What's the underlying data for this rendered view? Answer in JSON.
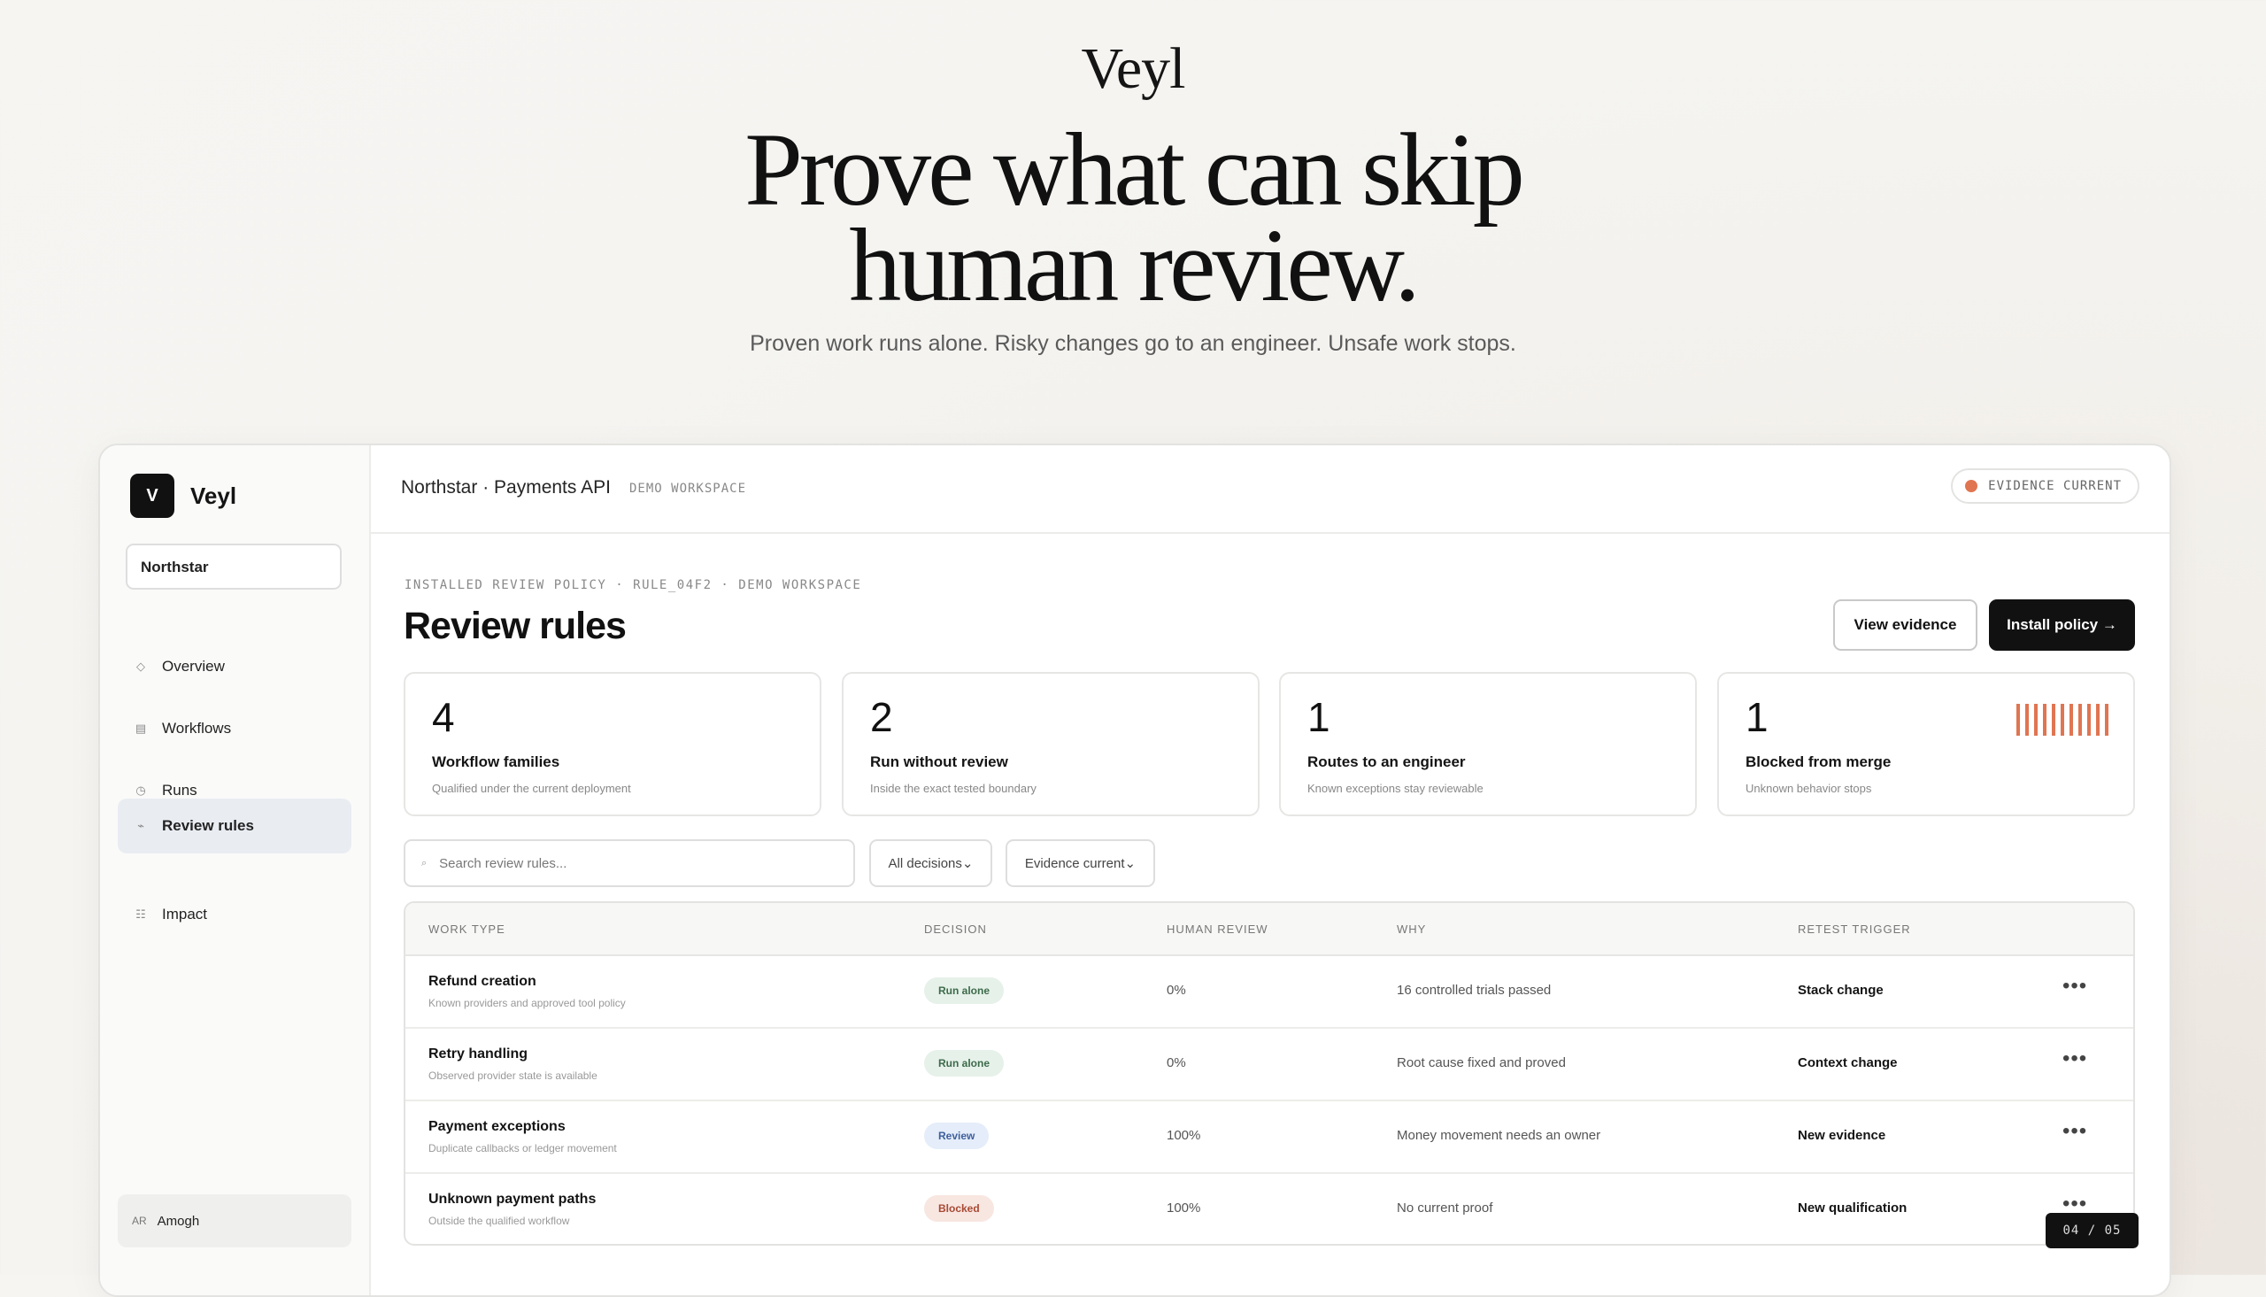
{
  "hero": {
    "brand": "Veyl",
    "title_line1": "Prove what can skip",
    "title_line2": "human review.",
    "subtitle": "Proven work runs alone. Risky changes go to an engineer. Unsafe work stops."
  },
  "sidebar": {
    "logo_letter": "V",
    "app_name": "Veyl",
    "workspace": "Northstar",
    "items": [
      {
        "label": "Overview",
        "icon": "diamond-icon",
        "glyph": "◇"
      },
      {
        "label": "Workflows",
        "icon": "grid-icon",
        "glyph": "▤"
      },
      {
        "label": "Runs",
        "icon": "clock-icon",
        "glyph": "◷"
      },
      {
        "label": "Review rules",
        "icon": "rule-icon",
        "glyph": "⌁"
      },
      {
        "label": "Impact",
        "icon": "list-icon",
        "glyph": "☷"
      }
    ],
    "active_item": "Review rules",
    "user": {
      "initials": "AR",
      "name": "Amogh"
    }
  },
  "topbar": {
    "breadcrumb": "Northstar · Payments API",
    "tag": "DEMO WORKSPACE",
    "evidence_status": "EVIDENCE CURRENT"
  },
  "main": {
    "eyebrow": "INSTALLED REVIEW POLICY · RULE_04F2 · DEMO WORKSPACE",
    "title": "Review rules",
    "view_evidence": "View evidence",
    "install_policy": "Install policy →",
    "cards": [
      {
        "num": "4",
        "label": "Workflow families",
        "sub": "Qualified under the current deployment"
      },
      {
        "num": "2",
        "label": "Run without review",
        "sub": "Inside the exact tested boundary"
      },
      {
        "num": "1",
        "label": "Routes to an engineer",
        "sub": "Known exceptions stay reviewable"
      },
      {
        "num": "1",
        "label": "Blocked from merge",
        "sub": "Unknown behavior stops"
      }
    ],
    "search_placeholder": "Search review rules...",
    "filter_decisions": "All decisions⌄",
    "filter_evidence": "Evidence current⌄"
  },
  "table": {
    "headers": {
      "work_type": "WORK TYPE",
      "decision": "DECISION",
      "human_review": "HUMAN REVIEW",
      "why": "WHY",
      "retest": "RETEST TRIGGER"
    },
    "rows": [
      {
        "title": "Refund creation",
        "sub": "Known providers and approved tool policy",
        "decision": "Run alone",
        "review": "0%",
        "why": "16 controlled trials passed",
        "trigger": "Stack change"
      },
      {
        "title": "Retry handling",
        "sub": "Observed provider state is available",
        "decision": "Run alone",
        "review": "0%",
        "why": "Root cause fixed and proved",
        "trigger": "Context change"
      },
      {
        "title": "Payment exceptions",
        "sub": "Duplicate callbacks or ledger movement",
        "decision": "Review",
        "review": "100%",
        "why": "Money movement needs an owner",
        "trigger": "New evidence"
      },
      {
        "title": "Unknown payment paths",
        "sub": "Outside the qualified workflow",
        "decision": "Blocked",
        "review": "100%",
        "why": "No current proof",
        "trigger": "New qualification"
      }
    ]
  },
  "pager": "04 / 05",
  "colors": {
    "accent": "#e07552",
    "run_alone_bg": "#e6f1ea",
    "run_alone_fg": "#3d6b4a",
    "review_bg": "#e4edf9",
    "review_fg": "#3f5f9c",
    "blocked_bg": "#f8e6e1",
    "blocked_fg": "#a84a34"
  }
}
